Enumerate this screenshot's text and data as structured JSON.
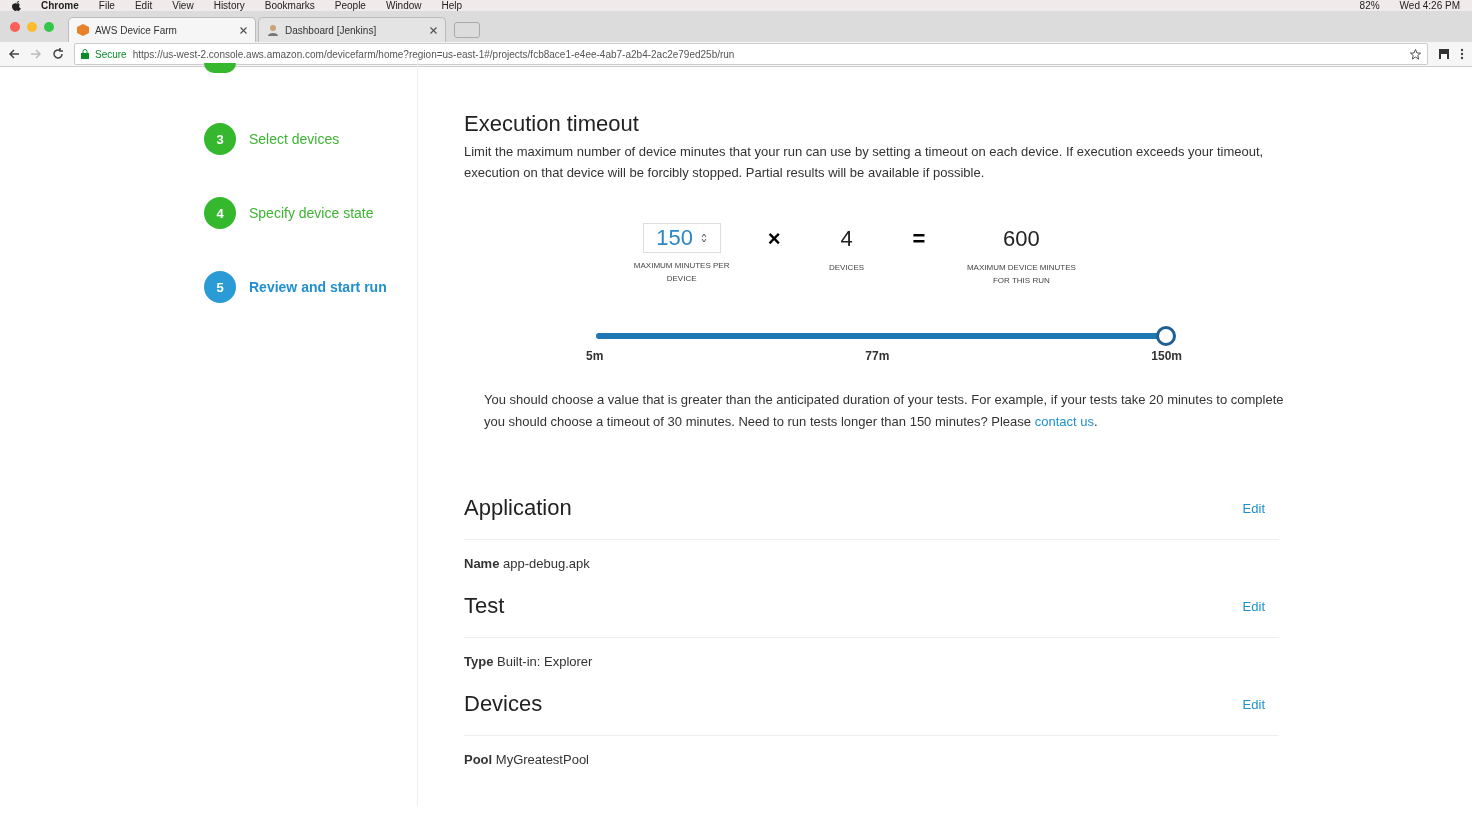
{
  "menu_bar": {
    "app": "Chrome",
    "items": [
      "File",
      "Edit",
      "View",
      "History",
      "Bookmarks",
      "People",
      "Window",
      "Help"
    ],
    "battery": "82%",
    "clock": "Wed 4:26 PM"
  },
  "tabs": [
    {
      "label": "AWS Device Farm",
      "selected": true
    },
    {
      "label": "Dashboard [Jenkins]",
      "selected": false
    }
  ],
  "address_bar": {
    "secure": "Secure",
    "url": "https://us-west-2.console.aws.amazon.com/devicefarm/home?region=us-east-1#/projects/fcb8ace1-e4ee-4ab7-a2b4-2ac2e79ed25b/run"
  },
  "steps": [
    {
      "number": "3",
      "label": "Select devices",
      "selected": false
    },
    {
      "number": "4",
      "label": "Specify device state",
      "selected": false
    },
    {
      "number": "5",
      "label": "Review and start run",
      "selected": true
    }
  ],
  "timeout": {
    "title": "Execution timeout",
    "description": "Limit the maximum number of device minutes that your run can use by setting a timeout on each device. If execution exceeds your timeout, execution on that device will be forcibly stopped. Partial results will be available if possible.",
    "minutes_value": "150",
    "minutes_label": "MAXIMUM MINUTES PER DEVICE",
    "times": "×",
    "devices_value": "4",
    "devices_label": "DEVICES",
    "equals": "=",
    "total_value": "600",
    "total_label": "MAXIMUM DEVICE MINUTES FOR THIS RUN",
    "slider": {
      "level": 1,
      "ticks": [
        "5m",
        "77m",
        "150m"
      ]
    },
    "note": "You should choose a value that is greater than the anticipated duration of your tests. For example, if your tests take 20 minutes to complete you should choose a timeout of 30 minutes. Need to run tests longer than 150 minutes? Please",
    "link": "contact us",
    "note_end": "."
  },
  "sections": [
    {
      "title": "Application",
      "action": "Edit",
      "field": "Name",
      "value": "app-debug.apk"
    },
    {
      "title": "Test",
      "action": "Edit",
      "field": "Type",
      "value": "Built-in: Explorer"
    },
    {
      "title": "Devices",
      "action": "Edit",
      "field": "Pool",
      "value": "MyGreatestPool"
    }
  ]
}
